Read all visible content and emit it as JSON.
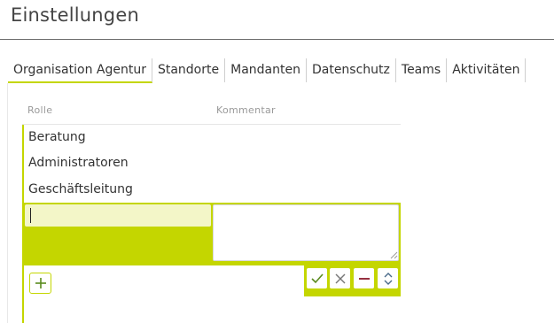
{
  "page": {
    "title": "Einstellungen"
  },
  "tabs": [
    {
      "label": "Organisation Agentur",
      "active": true
    },
    {
      "label": "Standorte",
      "active": false
    },
    {
      "label": "Mandanten",
      "active": false
    },
    {
      "label": "Datenschutz",
      "active": false
    },
    {
      "label": "Teams",
      "active": false
    },
    {
      "label": "Aktivitäten",
      "active": false
    }
  ],
  "table": {
    "columns": [
      "Rolle",
      "Kommentar"
    ],
    "rows": [
      {
        "rolle": "Beratung",
        "kommentar": ""
      },
      {
        "rolle": "Administratoren",
        "kommentar": ""
      },
      {
        "rolle": "Geschäftsleitung",
        "kommentar": ""
      }
    ],
    "edit_row": {
      "rolle_value": "",
      "kommentar_value": ""
    }
  },
  "actions": {
    "add_icon": "plus-icon",
    "confirm_icon": "check-icon",
    "cancel_icon": "close-icon",
    "delete_icon": "minus-icon",
    "reorder_icon": "chevron-up-down-icon"
  },
  "colors": {
    "accent": "#c4d600",
    "accent_light": "#f3f6c8",
    "confirm": "#5a8a1e",
    "cancel": "#777777",
    "delete": "#8b1a2b",
    "reorder": "#4a6a8a"
  }
}
